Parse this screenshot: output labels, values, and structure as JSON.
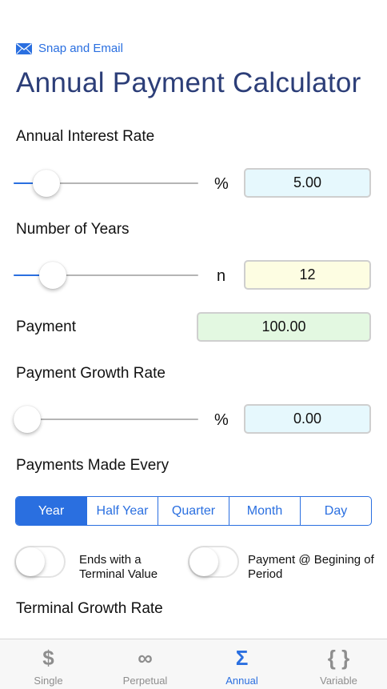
{
  "header": {
    "snap_label": "Snap and Email",
    "title": "Annual Payment Calculator"
  },
  "interest": {
    "label": "Annual Interest Rate",
    "unit": "%",
    "value": "5.00",
    "slider_level": 0.12
  },
  "years": {
    "label": "Number of Years",
    "unit": "n",
    "value": "12",
    "slider_level": 0.16
  },
  "payment": {
    "label": "Payment",
    "value": "100.00"
  },
  "growth": {
    "label": "Payment Growth Rate",
    "unit": "%",
    "value": "0.00",
    "slider_level": 0
  },
  "frequency": {
    "label": "Payments Made Every",
    "options": [
      "Year",
      "Half Year",
      "Quarter",
      "Month",
      "Day"
    ],
    "selected": "Year"
  },
  "toggles": {
    "terminal_value": {
      "label": "Ends with a Terminal Value",
      "on": false
    },
    "begin_period": {
      "label": "Payment @ Begining of Period",
      "on": false
    }
  },
  "terminal_growth": {
    "label": "Terminal Growth Rate"
  },
  "tabbar": {
    "tabs": [
      {
        "icon": "$",
        "icon_name": "dollar-icon",
        "label": "Single"
      },
      {
        "icon": "∞",
        "icon_name": "infinity-icon",
        "label": "Perpetual"
      },
      {
        "icon": "Σ",
        "icon_name": "sigma-icon",
        "label": "Annual"
      },
      {
        "icon": "{ }",
        "icon_name": "braces-icon",
        "label": "Variable"
      }
    ],
    "active": "Annual"
  },
  "colors": {
    "accent": "#2a6fe0",
    "title": "#2c3e78",
    "interest_field_bg": "#e6f8fd",
    "years_field_bg": "#fdfde2",
    "payment_field_bg": "#e3f8e1",
    "growth_field_bg": "#e6f8fd"
  }
}
